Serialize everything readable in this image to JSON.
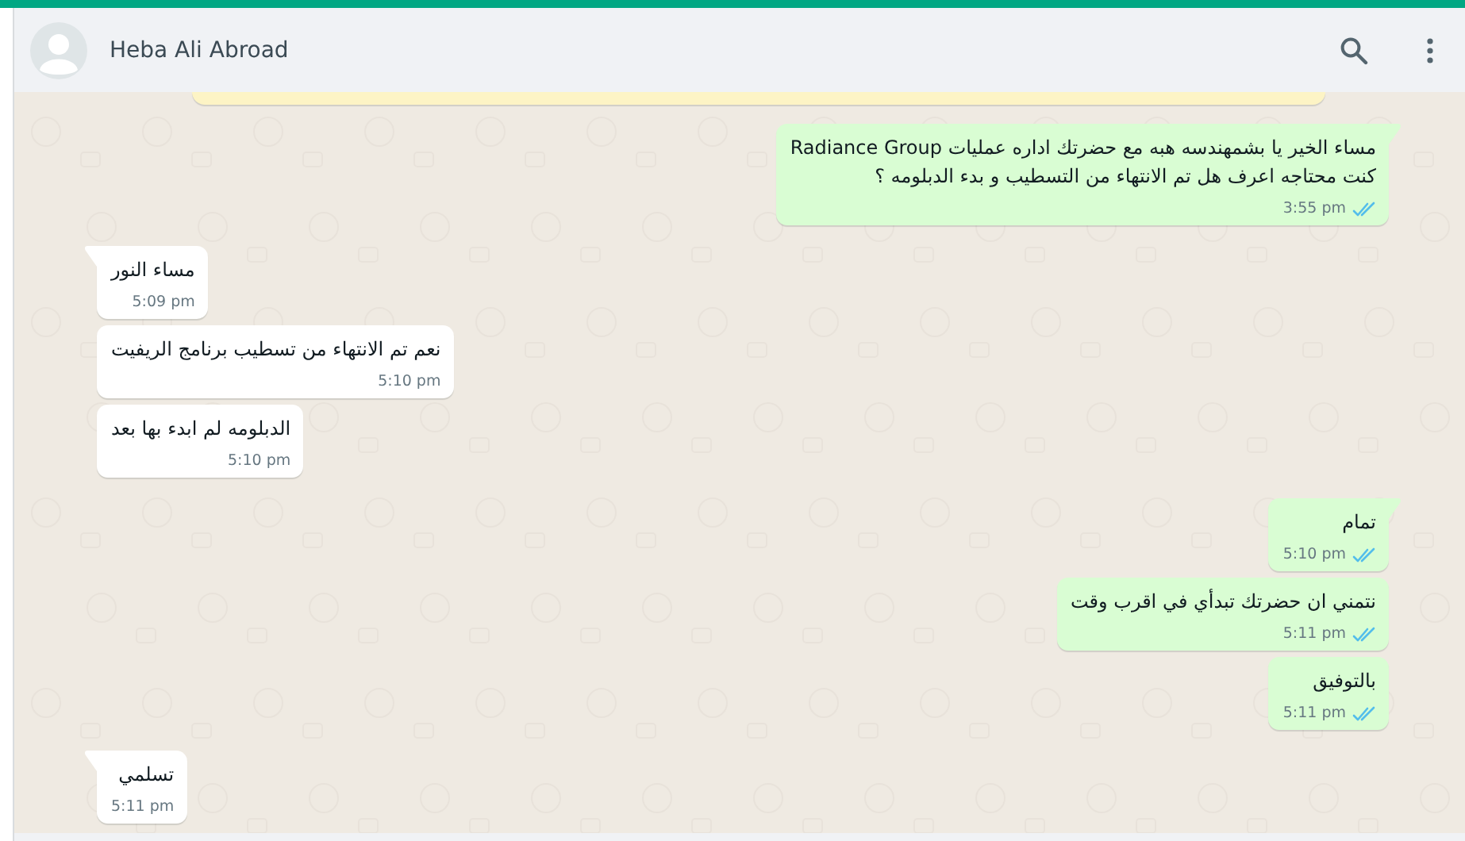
{
  "header": {
    "contact_name": "Heba Ali Abroad"
  },
  "messages": [
    {
      "kind": "out",
      "tail": true,
      "read": true,
      "text": "مساء الخير يا بشمهندسه هبه مع حضرتك اداره عمليات Radiance Group\nكنت محتاجه اعرف هل تم الانتهاء من التسطيب و بدء الدبلومه ؟",
      "time": "3:55 pm"
    },
    {
      "kind": "in",
      "tail": true,
      "text": "مساء النور",
      "time": "5:09 pm"
    },
    {
      "kind": "in",
      "tail": false,
      "text": "نعم تم الانتهاء من تسطيب برنامج الريفيت",
      "time": "5:10 pm"
    },
    {
      "kind": "in",
      "tail": false,
      "text": "الدبلومه لم ابدء بها بعد",
      "time": "5:10 pm"
    },
    {
      "kind": "out",
      "tail": true,
      "read": true,
      "text": "تمام",
      "time": "5:10 pm"
    },
    {
      "kind": "out",
      "tail": false,
      "read": true,
      "text": "نتمني ان حضرتك تبدأي في اقرب وقت",
      "time": "5:11 pm"
    },
    {
      "kind": "out",
      "tail": false,
      "read": true,
      "text": "بالتوفيق",
      "time": "5:11 pm"
    },
    {
      "kind": "in",
      "tail": true,
      "text": "تسلمي",
      "time": "5:11 pm"
    }
  ]
}
